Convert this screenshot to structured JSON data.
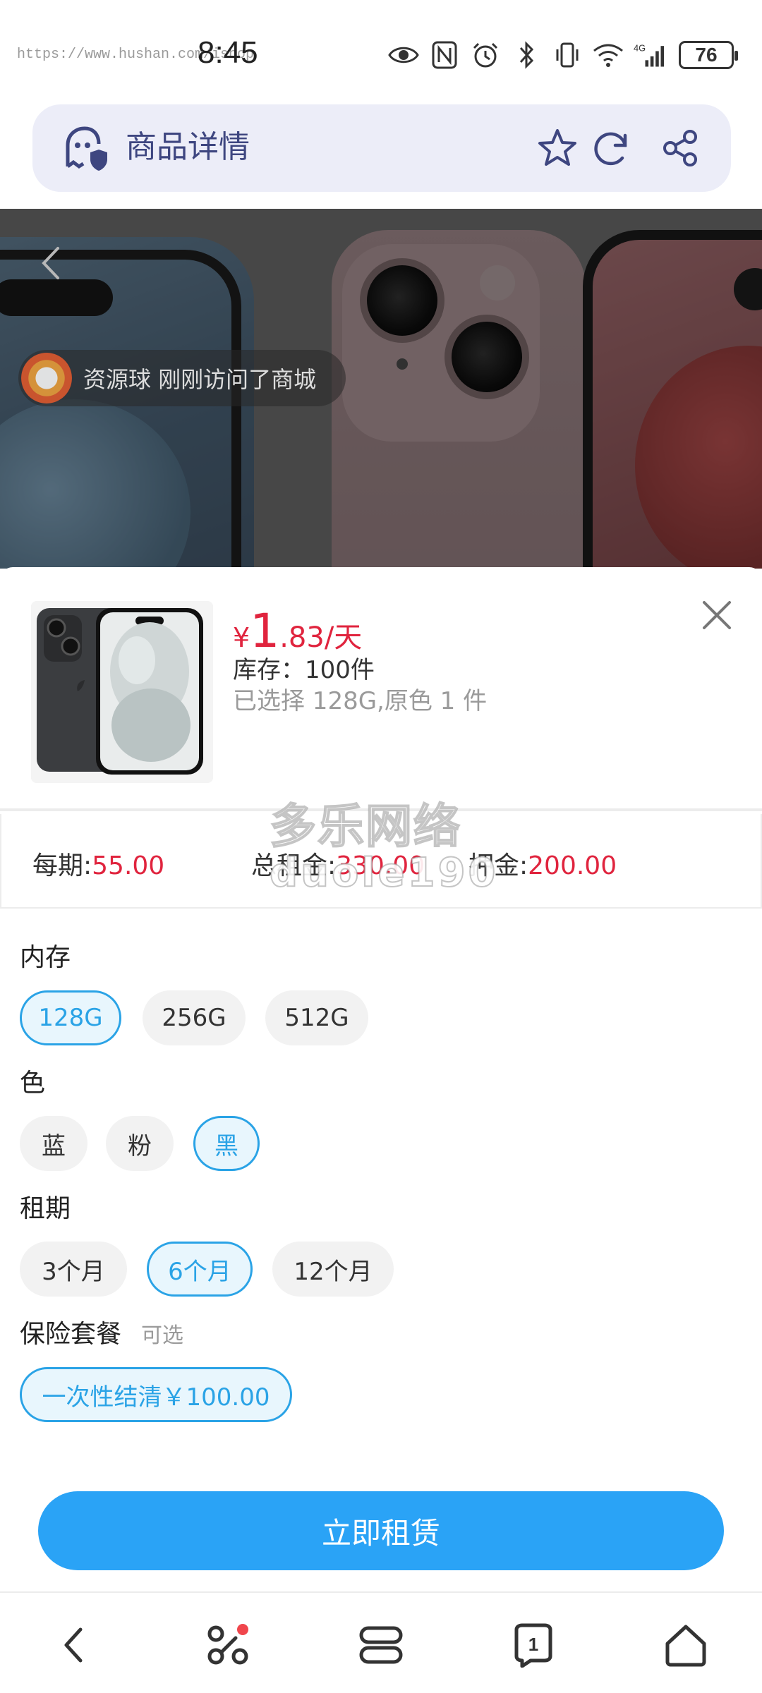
{
  "status_bar": {
    "url_overlay": "https://www.hushan.com/ishop",
    "time": "8:45",
    "network": "4G",
    "battery": "76"
  },
  "header": {
    "title": "商品详情"
  },
  "hero": {
    "visitor_notice": "资源球 刚刚访问了商城"
  },
  "product": {
    "price": {
      "currency": "¥",
      "integer": "1",
      "decimal": ".83",
      "unit": "/天"
    },
    "stock": "库存：100件",
    "selected": "已选择 128G,原色 1 件"
  },
  "fees": {
    "per_period_label": "每期:",
    "per_period_value": "55.00",
    "total_label": "总租金:",
    "total_value": "330.00",
    "deposit_label": "押金:",
    "deposit_value": "200.00"
  },
  "watermark": {
    "line1": "多乐网络",
    "line2": "duole190"
  },
  "options": {
    "memory": {
      "title": "内存",
      "choices": [
        "128G",
        "256G",
        "512G"
      ],
      "selected": "128G"
    },
    "color": {
      "title": "色",
      "choices": [
        "蓝",
        "粉",
        "黑"
      ],
      "selected": "黑"
    },
    "term": {
      "title": "租期",
      "choices": [
        "3个月",
        "6个月",
        "12个月"
      ],
      "selected": "6个月"
    },
    "insurance": {
      "title": "保险套餐",
      "subtitle": "可选",
      "choices": [
        "一次性结清￥100.00"
      ],
      "selected": "一次性结清￥100.00"
    }
  },
  "actions": {
    "rent_now": "立即租赁"
  },
  "nav": {
    "tabs_count": "1"
  },
  "colors": {
    "accent": "#2aa3f6",
    "price_red": "#e0243e",
    "header_bg": "#ecedf8",
    "header_text": "#3e4680"
  }
}
